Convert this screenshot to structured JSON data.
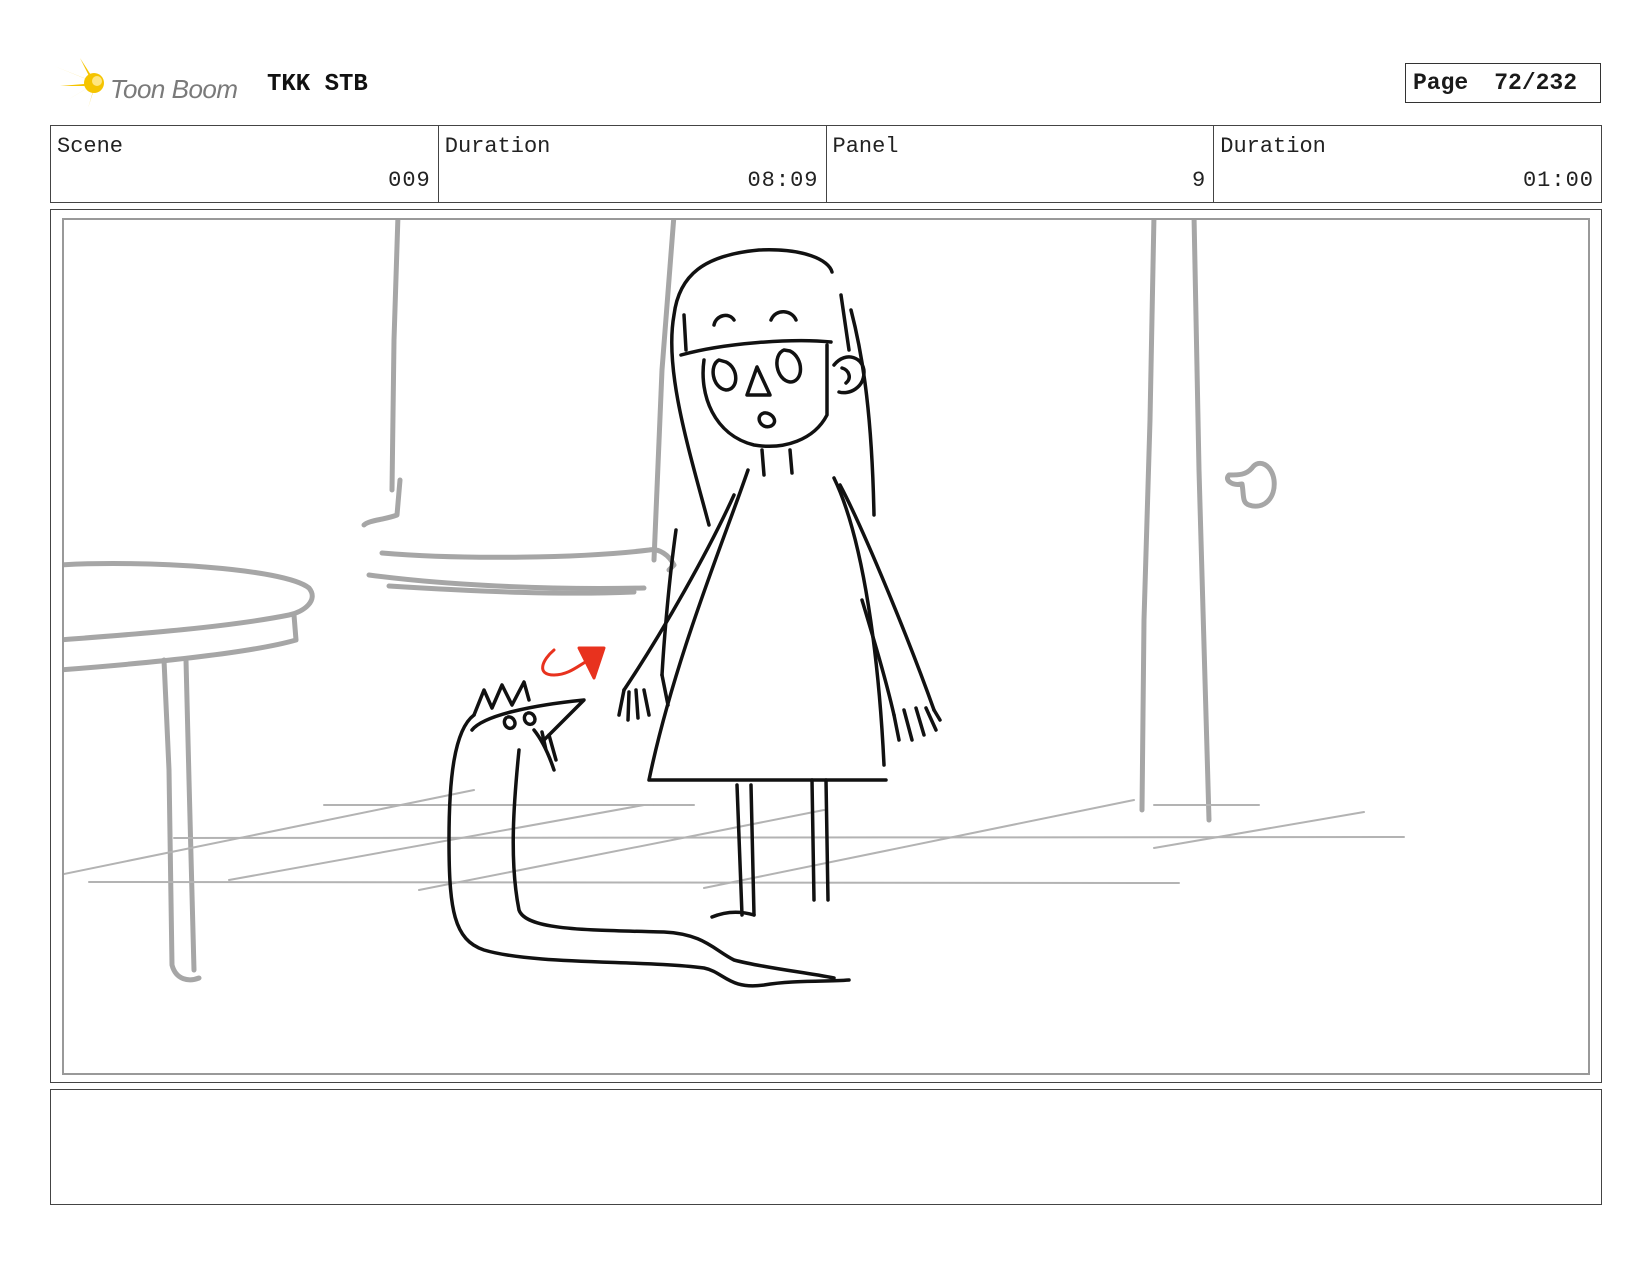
{
  "header": {
    "logo_text": "Toon Boom",
    "project": "TKK STB",
    "page_label": "Page",
    "page_value": "72/232"
  },
  "info": [
    {
      "label": "Scene",
      "value": "009"
    },
    {
      "label": "Duration",
      "value": "08:09"
    },
    {
      "label": "Panel",
      "value": "9"
    },
    {
      "label": "Duration",
      "value": "01:00"
    }
  ],
  "panel": {
    "image_name": "storyboard-sketch"
  },
  "notes": {
    "text": ""
  },
  "colors": {
    "logo_yellow": "#f5c400",
    "sketch_gray": "#a6a6a6",
    "line_black": "#111111",
    "annotation_red": "#e8321e"
  }
}
